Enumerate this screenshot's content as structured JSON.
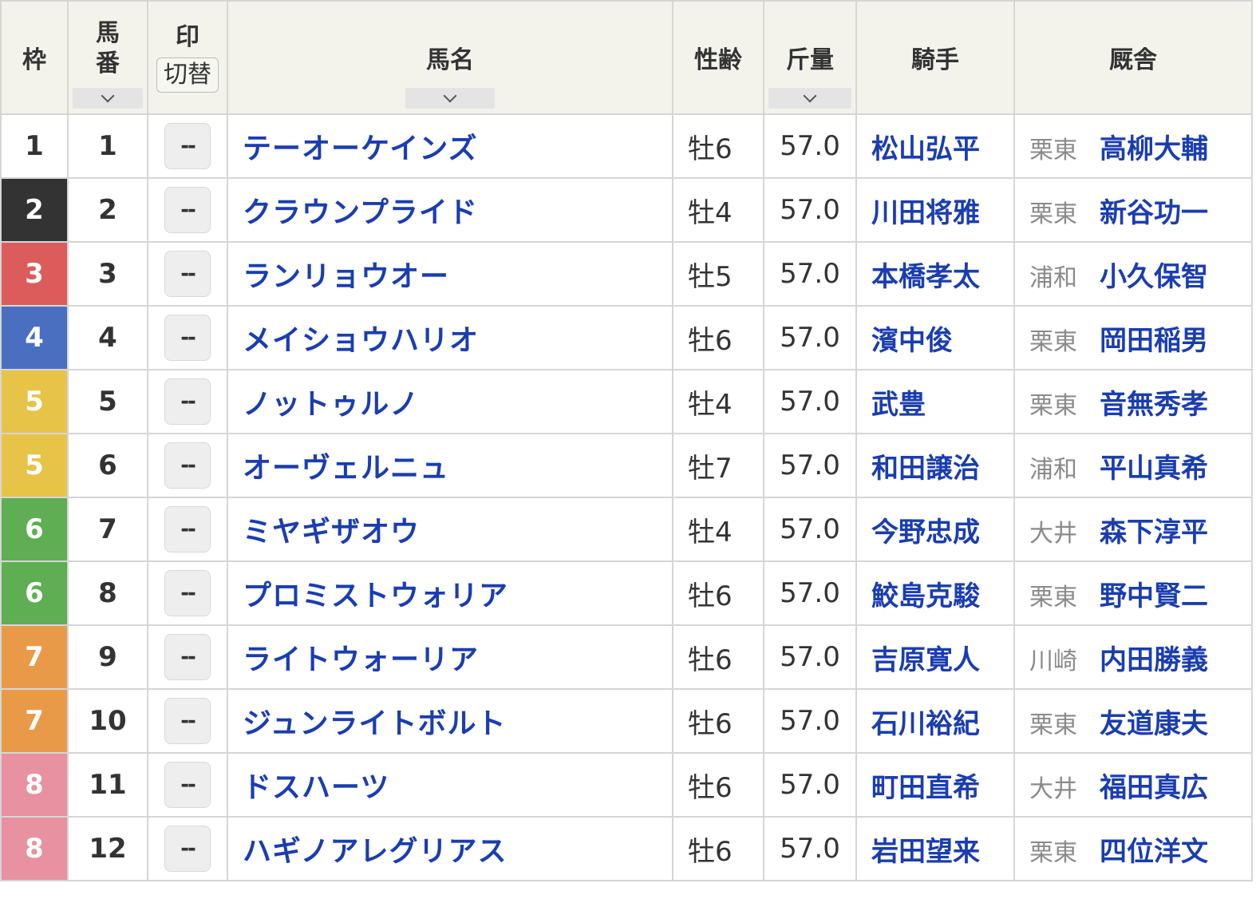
{
  "headers": {
    "waku": "枠",
    "umaban_line1": "馬",
    "umaban_line2": "番",
    "mark": "印",
    "mark_switch": "切替",
    "horse_name": "馬名",
    "sex_age": "性齢",
    "weight": "斤量",
    "jockey": "騎手",
    "stable": "厩舎"
  },
  "waku_colors": {
    "1": {
      "bg": "#ffffff",
      "fg": "#333333"
    },
    "2": {
      "bg": "#333333",
      "fg": "#ffffff"
    },
    "3": {
      "bg": "#dc5c5c",
      "fg": "#ffffff"
    },
    "4": {
      "bg": "#4a6fc1",
      "fg": "#ffffff"
    },
    "5": {
      "bg": "#e7c447",
      "fg": "#ffffff"
    },
    "6": {
      "bg": "#5fae54",
      "fg": "#ffffff"
    },
    "7": {
      "bg": "#e89a49",
      "fg": "#ffffff"
    },
    "8": {
      "bg": "#e891a0",
      "fg": "#ffffff"
    }
  },
  "rows": [
    {
      "waku": "1",
      "umaban": "1",
      "mark": "--",
      "horse": "テーオーケインズ",
      "sex_age": "牡6",
      "weight": "57.0",
      "jockey": "松山弘平",
      "stable_loc": "栗東",
      "trainer": "高柳大輔"
    },
    {
      "waku": "2",
      "umaban": "2",
      "mark": "--",
      "horse": "クラウンプライド",
      "sex_age": "牡4",
      "weight": "57.0",
      "jockey": "川田将雅",
      "stable_loc": "栗東",
      "trainer": "新谷功一"
    },
    {
      "waku": "3",
      "umaban": "3",
      "mark": "--",
      "horse": "ランリョウオー",
      "sex_age": "牡5",
      "weight": "57.0",
      "jockey": "本橋孝太",
      "stable_loc": "浦和",
      "trainer": "小久保智"
    },
    {
      "waku": "4",
      "umaban": "4",
      "mark": "--",
      "horse": "メイショウハリオ",
      "sex_age": "牡6",
      "weight": "57.0",
      "jockey": "濱中俊",
      "stable_loc": "栗東",
      "trainer": "岡田稲男"
    },
    {
      "waku": "5",
      "umaban": "5",
      "mark": "--",
      "horse": "ノットゥルノ",
      "sex_age": "牡4",
      "weight": "57.0",
      "jockey": "武豊",
      "stable_loc": "栗東",
      "trainer": "音無秀孝"
    },
    {
      "waku": "5",
      "umaban": "6",
      "mark": "--",
      "horse": "オーヴェルニュ",
      "sex_age": "牡7",
      "weight": "57.0",
      "jockey": "和田譲治",
      "stable_loc": "浦和",
      "trainer": "平山真希"
    },
    {
      "waku": "6",
      "umaban": "7",
      "mark": "--",
      "horse": "ミヤギザオウ",
      "sex_age": "牡4",
      "weight": "57.0",
      "jockey": "今野忠成",
      "stable_loc": "大井",
      "trainer": "森下淳平"
    },
    {
      "waku": "6",
      "umaban": "8",
      "mark": "--",
      "horse": "プロミストウォリア",
      "sex_age": "牡6",
      "weight": "57.0",
      "jockey": "鮫島克駿",
      "stable_loc": "栗東",
      "trainer": "野中賢二"
    },
    {
      "waku": "7",
      "umaban": "9",
      "mark": "--",
      "horse": "ライトウォーリア",
      "sex_age": "牡6",
      "weight": "57.0",
      "jockey": "吉原寛人",
      "stable_loc": "川崎",
      "trainer": "内田勝義"
    },
    {
      "waku": "7",
      "umaban": "10",
      "mark": "--",
      "horse": "ジュンライトボルト",
      "sex_age": "牡6",
      "weight": "57.0",
      "jockey": "石川裕紀",
      "stable_loc": "栗東",
      "trainer": "友道康夫"
    },
    {
      "waku": "8",
      "umaban": "11",
      "mark": "--",
      "horse": "ドスハーツ",
      "sex_age": "牡6",
      "weight": "57.0",
      "jockey": "町田直希",
      "stable_loc": "大井",
      "trainer": "福田真広"
    },
    {
      "waku": "8",
      "umaban": "12",
      "mark": "--",
      "horse": "ハギノアレグリアス",
      "sex_age": "牡6",
      "weight": "57.0",
      "jockey": "岩田望来",
      "stable_loc": "栗東",
      "trainer": "四位洋文"
    }
  ]
}
